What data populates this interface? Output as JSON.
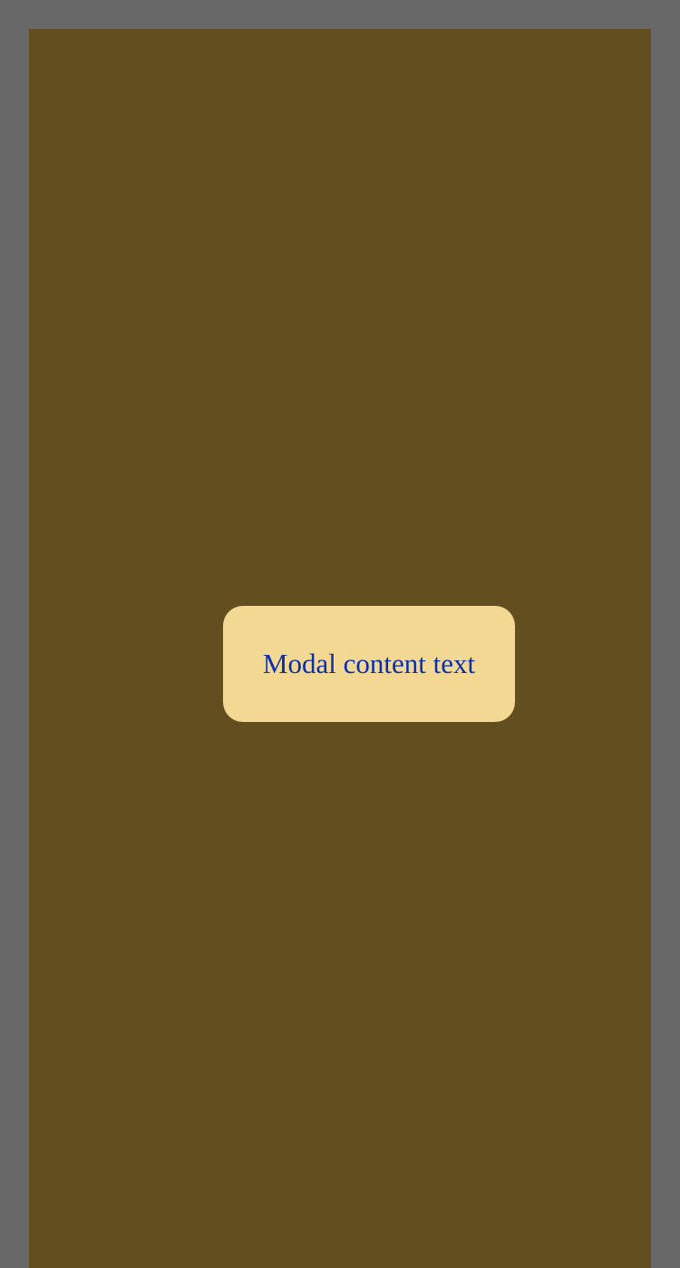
{
  "modal": {
    "text": "Modal content text"
  },
  "colors": {
    "page_background": "#686868",
    "overlay_background": "#634e1f",
    "modal_background": "#f2d893",
    "modal_text": "#0b2fa8"
  }
}
